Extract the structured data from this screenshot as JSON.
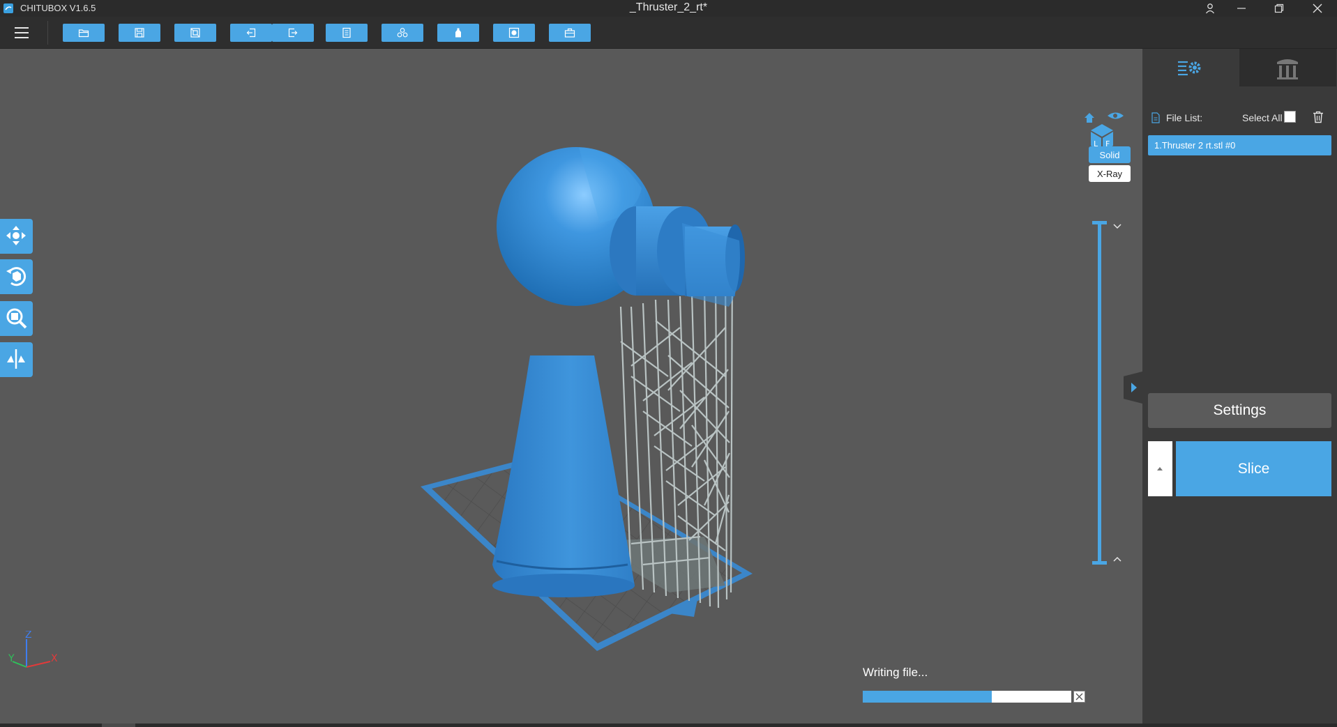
{
  "window": {
    "app_title": "CHITUBOX V1.6.5",
    "document_title": "_Thruster_2_rt*"
  },
  "toolbar": {
    "buttons": [
      {
        "name": "open-file-button",
        "icon": "folder-icon"
      },
      {
        "name": "save-file-button",
        "icon": "save-icon"
      },
      {
        "name": "auto-layout-button",
        "icon": "layout-icon"
      },
      {
        "name": "undo-button",
        "icon": "undo-icon"
      },
      {
        "name": "redo-button",
        "icon": "redo-icon"
      },
      {
        "name": "model-list-button",
        "icon": "list-icon"
      },
      {
        "name": "multiply-button",
        "icon": "clone-icon"
      },
      {
        "name": "hollow-button",
        "icon": "bottle-icon"
      },
      {
        "name": "dig-hole-button",
        "icon": "hole-icon"
      },
      {
        "name": "repair-button",
        "icon": "toolbox-icon"
      }
    ]
  },
  "view": {
    "solid_label": "Solid",
    "xray_label": "X-Ray",
    "axis": {
      "x": "X",
      "y": "Y",
      "z": "Z"
    }
  },
  "progress": {
    "label": "Writing file...",
    "fraction": 0.62
  },
  "side_panel": {
    "file_list_label": "File List:",
    "select_all_label": "Select All",
    "files": [
      "1.Thruster 2 rt.stl #0"
    ],
    "settings_label": "Settings",
    "slice_label": "Slice"
  },
  "colors": {
    "accent": "#4aa6e4",
    "model_blue": "#3d8fd6",
    "support_gray": "#b9c3c3",
    "viewport_bg": "#595959",
    "panel_bg": "#3a3a3a"
  }
}
